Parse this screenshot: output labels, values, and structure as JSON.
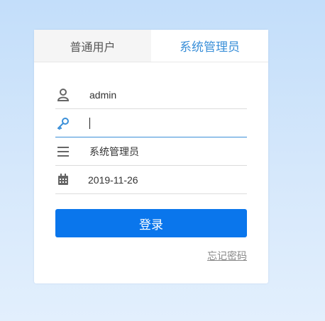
{
  "tabs": {
    "user_label": "普通用户",
    "admin_label": "系统管理员"
  },
  "form": {
    "username": "admin",
    "password": "",
    "role": "系统管理员",
    "date": "2019-11-26"
  },
  "icons": {
    "username": "user-icon",
    "password": "key-icon",
    "role": "menu-icon",
    "date": "calendar-icon"
  },
  "actions": {
    "login_label": "登录",
    "forgot_label": "忘记密码"
  },
  "colors": {
    "accent": "#0a76ec",
    "tab_active_text": "#3a8fd8"
  }
}
